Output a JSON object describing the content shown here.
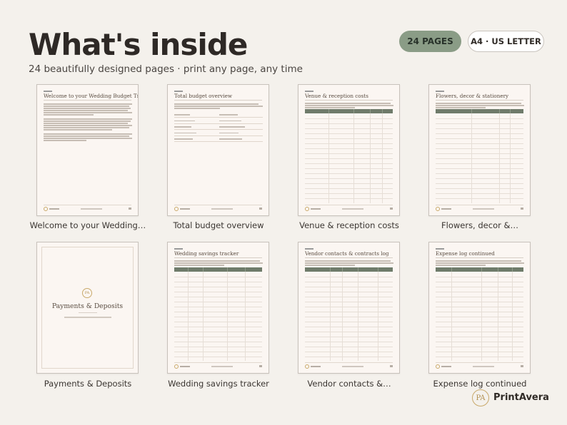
{
  "header": {
    "title": "What's inside",
    "subtitle": "24 beautifully designed pages · print any page, any time",
    "badge_pages": "24 PAGES",
    "badge_format": "A4 · US LETTER"
  },
  "pages": [
    {
      "caption": "Welcome to your Wedding…",
      "page_title": "Welcome to your Wedding Budget Tracker"
    },
    {
      "caption": "Total budget overview",
      "page_title": "Total budget overview"
    },
    {
      "caption": "Venue & reception costs",
      "page_title": "Venue & reception costs"
    },
    {
      "caption": "Flowers, decor &…",
      "page_title": "Flowers, decor & stationery"
    },
    {
      "caption": "Payments & Deposits",
      "page_title": "Payments & Deposits",
      "cover_badge": "PA"
    },
    {
      "caption": "Wedding savings tracker",
      "page_title": "Wedding savings tracker"
    },
    {
      "caption": "Vendor contacts &…",
      "page_title": "Vendor contacts & contracts log"
    },
    {
      "caption": "Expense log continued",
      "page_title": "Expense log continued"
    }
  ],
  "brand": {
    "logo": "PA",
    "name": "PrintAvera"
  },
  "colors": {
    "background": "#f4f1ec",
    "page": "#fbf6f2",
    "accent_green": "#8a9c86",
    "table_header": "#6f7b6a",
    "gold": "#c9a96a"
  }
}
